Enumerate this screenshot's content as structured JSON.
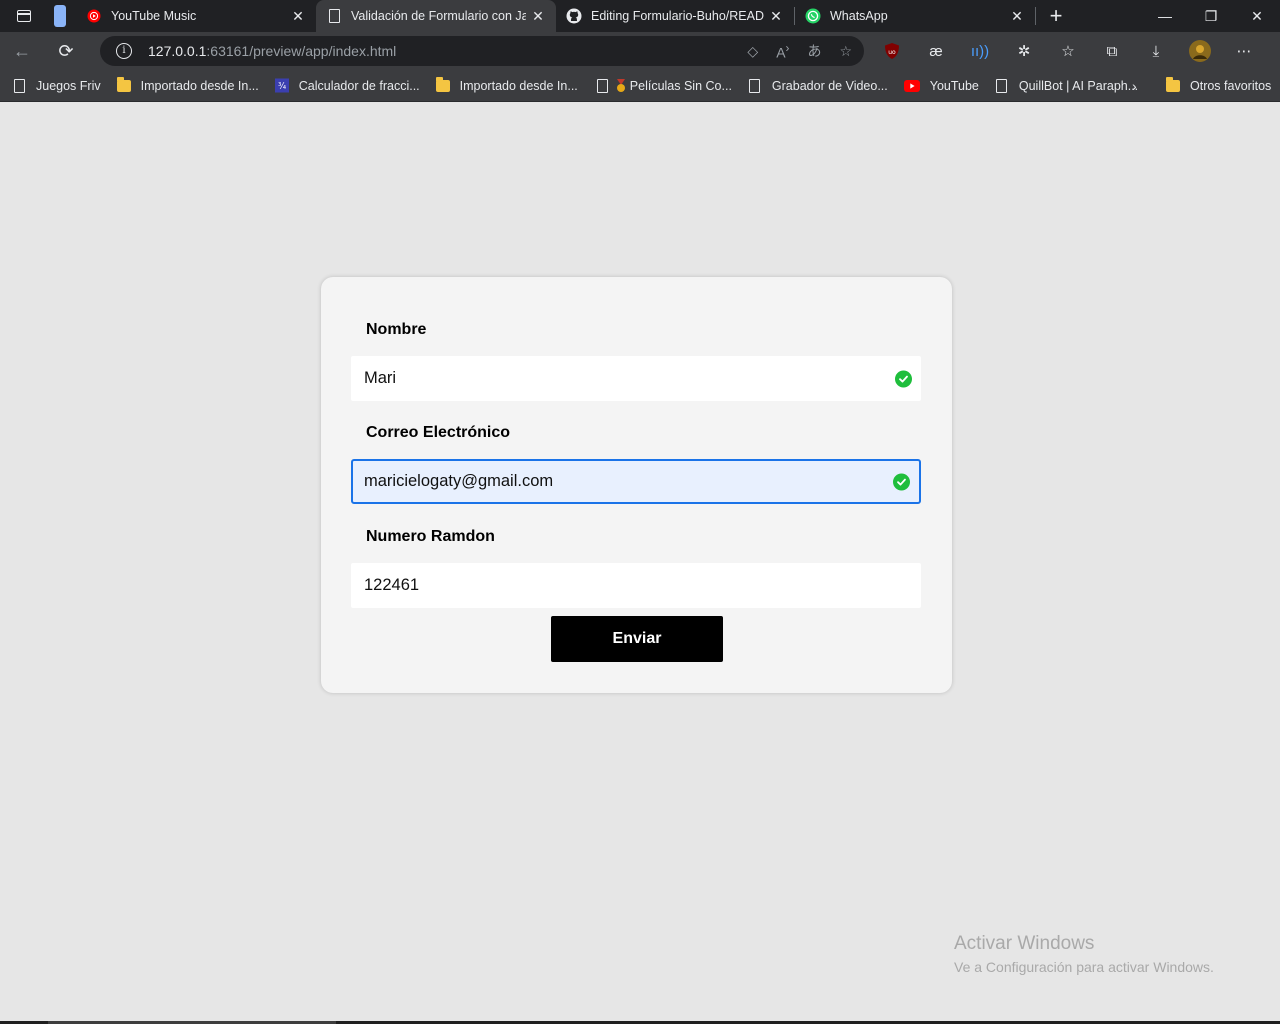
{
  "browser": {
    "tabs": [
      {
        "label": "YouTube Music",
        "icon": "youtube-music-icon"
      },
      {
        "label": "Validación de Formulario con JavaScript",
        "icon": "page-icon",
        "active": true
      },
      {
        "label": "Editing Formulario-Buho/README.md",
        "icon": "github-icon"
      },
      {
        "label": "WhatsApp",
        "icon": "whatsapp-icon"
      }
    ],
    "address": {
      "host": "127.0.0.1",
      "rest": ":63161/preview/app/index.html"
    },
    "bookmarks": [
      {
        "label": "Juegos Friv",
        "icon": "page-icon"
      },
      {
        "label": "Importado desde In...",
        "icon": "folder-icon"
      },
      {
        "label": "Calculador de fracci...",
        "icon": "fraction-icon"
      },
      {
        "label": "Importado desde In...",
        "icon": "folder-icon"
      },
      {
        "label": "Películas Sin Co...",
        "icon": "medal-icon"
      },
      {
        "label": "Grabador de Video...",
        "icon": "page-icon"
      },
      {
        "label": "YouTube",
        "icon": "youtube-icon"
      },
      {
        "label": "QuillBot | AI Paraph...",
        "icon": "page-icon"
      }
    ],
    "other_bookmarks": "Otros favoritos"
  },
  "form": {
    "name_label": "Nombre",
    "name_value": "Mari",
    "email_label": "Correo Electrónico",
    "email_value": "maricielogaty@gmail.com",
    "random_label": "Numero Ramdon",
    "random_value": "122461",
    "submit_label": "Enviar",
    "valid_color": "#1fbe3c"
  },
  "watermark": {
    "title": "Activar Windows",
    "subtitle": "Ve a Configuración para activar Windows."
  }
}
